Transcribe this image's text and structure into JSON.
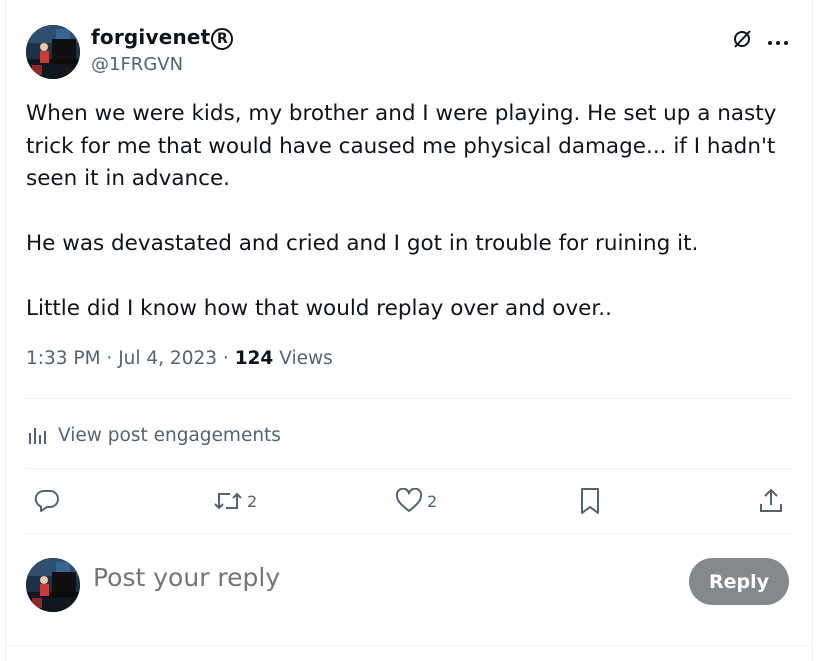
{
  "post": {
    "author": {
      "name": "forgivenet",
      "badge": "®",
      "handle": "@1FRGVN",
      "avatar_icon": "pianist-avatar"
    },
    "body": [
      "When we were kids, my brother and I were playing. He set up a nasty trick for me that would have caused me physical damage... if I hadn't seen it in advance.",
      "He was devastated and cried and I got in trouble for ruining it.",
      "Little did I know how that would replay over and over.."
    ],
    "time": "1:33 PM",
    "date": "Jul 4, 2023",
    "views_count": "124",
    "views_label": "Views",
    "engagements_label": "View post engagements"
  },
  "actions": {
    "reply_count": "",
    "repost_count": "2",
    "like_count": "2"
  },
  "composer": {
    "placeholder": "Post your reply",
    "button_label": "Reply"
  },
  "icons": {
    "top_right": [
      "grok-icon",
      "more-icon"
    ],
    "actions": [
      "reply-icon",
      "repost-icon",
      "like-icon",
      "bookmark-icon",
      "share-icon"
    ],
    "engagements": "analytics-icon"
  },
  "colors": {
    "text": "#0f1419",
    "secondary": "#536471",
    "divider": "#eff3f4",
    "reply_button": "#86898c"
  }
}
